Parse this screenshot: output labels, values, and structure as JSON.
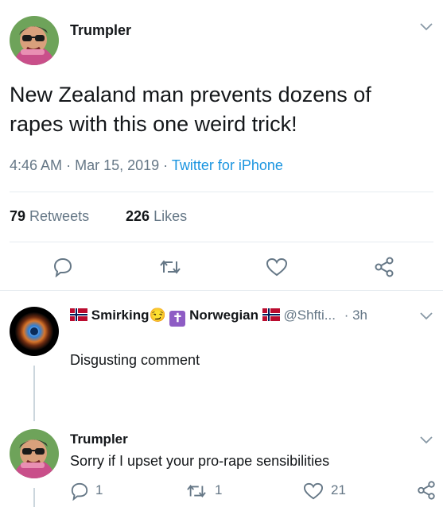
{
  "main_tweet": {
    "author": "Trumpler",
    "text": "New Zealand man prevents dozens of rapes with this one weird trick!",
    "time": "4:46 AM",
    "sep1": "·",
    "date": "Mar 15, 2019",
    "sep2": "·",
    "source": "Twitter for iPhone",
    "retweets_count": "79",
    "retweets_label": "Retweets",
    "likes_count": "226",
    "likes_label": "Likes",
    "icons": [
      "reply-icon",
      "retweet-icon",
      "like-icon",
      "share-icon",
      "chevron-down-icon"
    ]
  },
  "reply_1": {
    "name_part1": "Smirking",
    "smirk_emoji": "😏",
    "cross_emoji": "✝",
    "name_part2": "Norwegian",
    "handle": "@Shfti...",
    "time": "· 3h",
    "text": "Disgusting comment"
  },
  "reply_2": {
    "author": "Trumpler",
    "text": "Sorry if I upset your pro-rape sensibilities",
    "reply_count": "1",
    "retweet_count": "1",
    "like_count": "21"
  },
  "colors": {
    "link_blue": "#1b95e0",
    "secondary_gray": "#657786",
    "divider": "#e6ecf0",
    "flag_red": "#ba0c2f",
    "flag_blue": "#00205b"
  }
}
